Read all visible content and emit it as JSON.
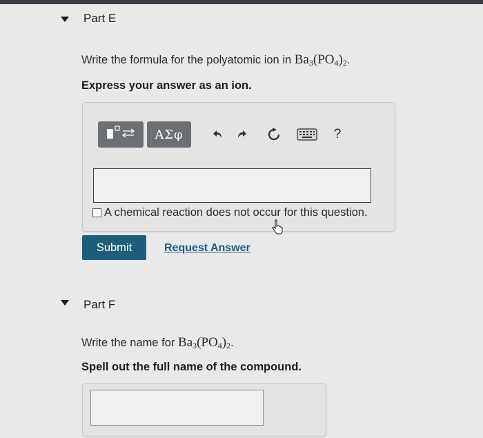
{
  "part_e": {
    "title": "Part E",
    "question_prefix": "Write the formula for the polyatomic ion in ",
    "formula": {
      "element": "Ba",
      "element_count": "3",
      "group_open": "(",
      "group_atom": "P",
      "group_oxygen": "O",
      "group_oxygen_count": "4",
      "group_close": ")",
      "group_count": "2"
    },
    "question_suffix": ".",
    "instruction": "Express your answer as an ion.",
    "toolbar": {
      "template_icon": "template-fraction-icon",
      "greek_label": "ΑΣφ",
      "undo_icon": "undo-arrow-icon",
      "redo_icon": "redo-arrow-icon",
      "reset_icon": "reset-icon",
      "keyboard_icon": "keyboard-icon",
      "help_label": "?"
    },
    "answer_value": "",
    "checkbox_label": "A chemical reaction does not occur for this question.",
    "submit_label": "Submit",
    "request_answer_label": "Request Answer"
  },
  "part_f": {
    "title": "Part F",
    "question_prefix": "Write the name for ",
    "formula": {
      "element": "Ba",
      "element_count": "3",
      "group_open": "(",
      "group_atom": "P",
      "group_oxygen": "O",
      "group_oxygen_count": "4",
      "group_close": ")",
      "group_count": "2"
    },
    "question_suffix": ".",
    "instruction": "Spell out the full name of the compound.",
    "answer_value": ""
  },
  "colors": {
    "submit_bg": "#1e5e7b",
    "link": "#1f5d83",
    "toolbar_button": "#6c6f73",
    "page_bg": "#e9e9ea"
  }
}
